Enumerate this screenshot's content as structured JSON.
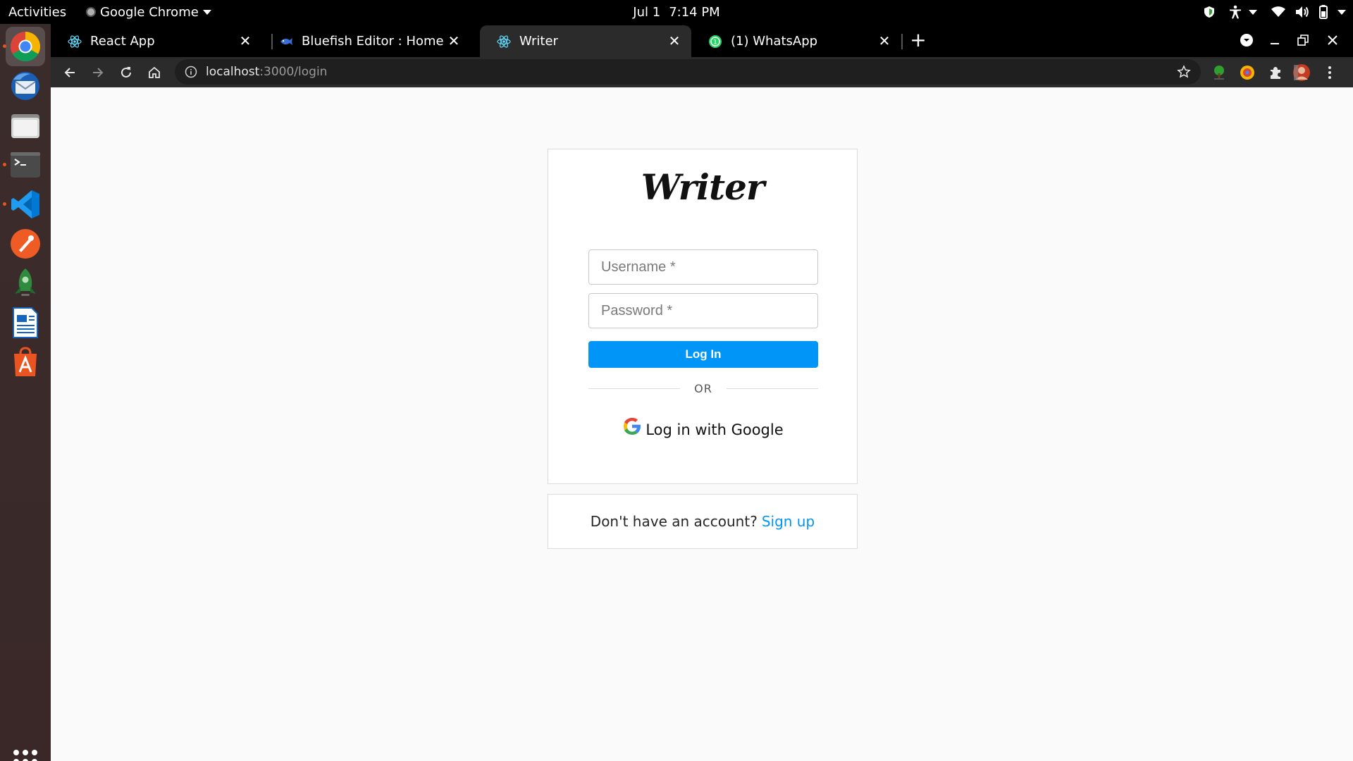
{
  "system": {
    "activities": "Activities",
    "app_name": "Google Chrome",
    "date": "Jul 1",
    "time": "7:14 PM"
  },
  "dock": {
    "items": [
      "chrome-icon",
      "thunderbird-icon",
      "files-icon",
      "terminal-icon",
      "vscode-icon",
      "postman-icon",
      "rocket-icon",
      "libreoffice-writer-icon",
      "software-center-icon"
    ],
    "apps_grid_icon": "show-applications-icon"
  },
  "browser": {
    "tabs": [
      {
        "title": "React App",
        "icon": "react-icon"
      },
      {
        "title": "Bluefish Editor : Home",
        "icon": "bluefish-icon"
      },
      {
        "title": "Writer",
        "icon": "react-icon",
        "active": true
      },
      {
        "title": "(1) WhatsApp",
        "icon": "whatsapp-icon"
      }
    ],
    "url_host": "localhost",
    "url_path": ":3000/login"
  },
  "page": {
    "logo": "Writer",
    "username_placeholder": "Username *",
    "password_placeholder": "Password *",
    "login_button": "Log In",
    "divider": "OR",
    "google_login": "Log in with Google",
    "signup_prompt": "Don't have an account?",
    "signup_link": "Sign up"
  },
  "colors": {
    "accent": "#0095f6",
    "page_bg": "#fafafa",
    "dock_bg": "#3b2c2c"
  }
}
